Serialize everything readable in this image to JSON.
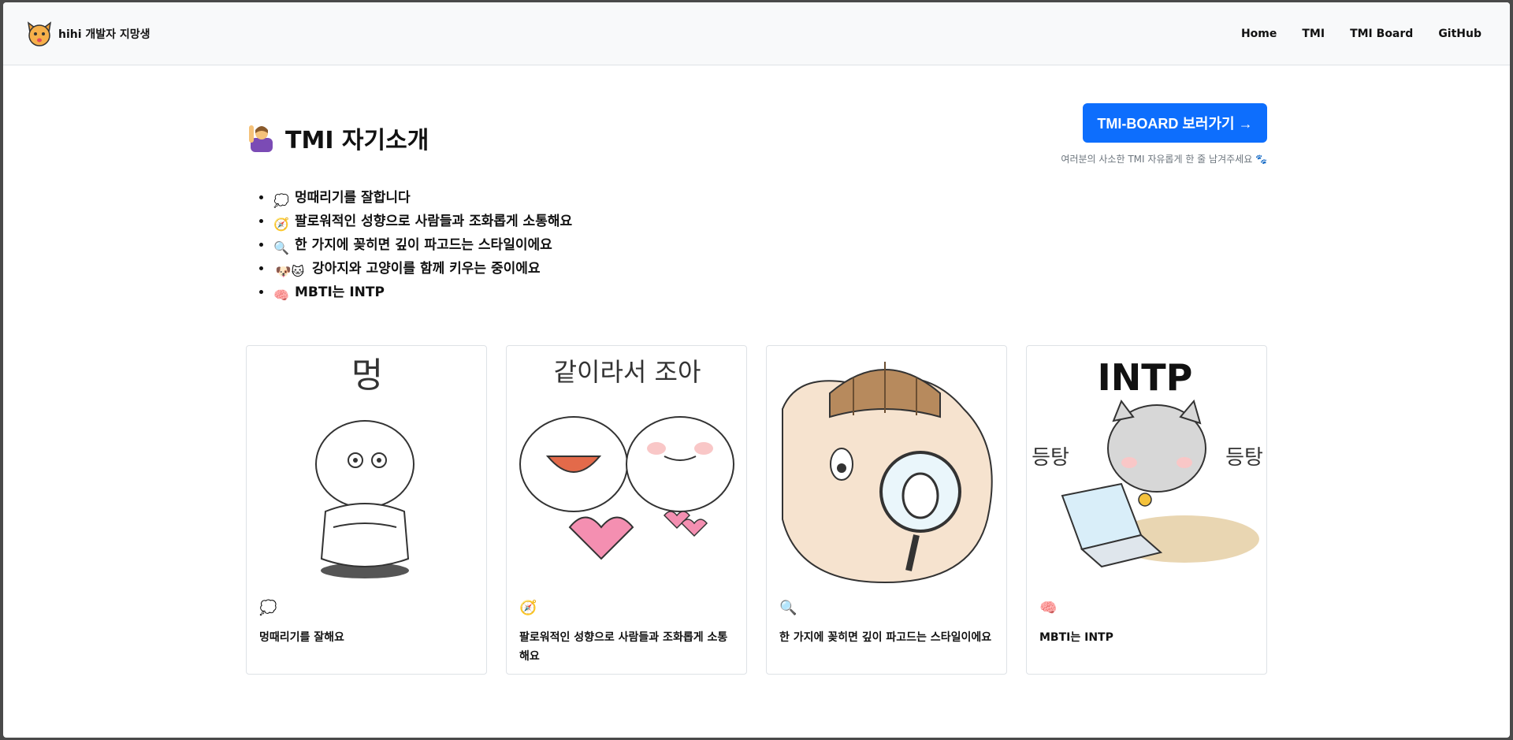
{
  "navbar": {
    "brand": "hihi 개발자 지망생",
    "links": [
      "Home",
      "TMI",
      "TMI Board",
      "GitHub"
    ]
  },
  "header": {
    "title_icon": "person-raising-hand-emoji",
    "title": "TMI 자기소개",
    "cta_label": "TMI-BOARD 보러가기 →",
    "cta_sub": "여러분의 사소한 TMI 자유롭게 한 줄 남겨주세요 🐾"
  },
  "tmi_list": [
    {
      "icon": "💭",
      "text": "멍때리기를 잘합니다"
    },
    {
      "icon": "🧭",
      "text": "팔로워적인 성향으로 사람들과 조화롭게 소통해요"
    },
    {
      "icon": "🔍",
      "text": "한 가지에 꽂히면 깊이 파고드는 스타일이에요"
    },
    {
      "icon": "🐶🐱",
      "text": "강아지와 고양이를 함께 키우는 중이에요"
    },
    {
      "icon": "🧠",
      "text": "MBTI는 INTP"
    }
  ],
  "cards": [
    {
      "image_text": "멍",
      "icon": "💭",
      "text": "멍때리기를 잘해요"
    },
    {
      "image_text": "같이라서 조아",
      "icon": "🧭",
      "text": "팔로워적인 성향으로 사람들과 조화롭게 소통해요"
    },
    {
      "image_text": "",
      "icon": "🔍",
      "text": "한 가지에 꽂히면 깊이 파고드는 스타일이에요"
    },
    {
      "image_text": "INTP",
      "image_side_text": "등탕",
      "icon": "🧠",
      "text": "MBTI는 INTP"
    }
  ],
  "colors": {
    "primary": "#0d6efd",
    "navbar_bg": "#f8f9fa",
    "muted": "#6c757d"
  }
}
